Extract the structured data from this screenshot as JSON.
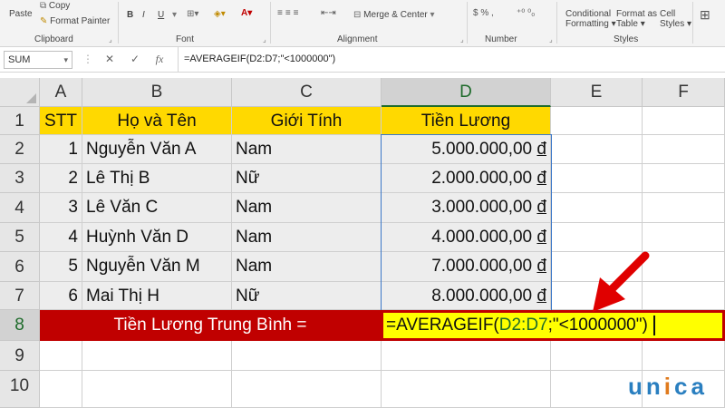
{
  "ribbon": {
    "paste": "Paste",
    "copy": "Copy",
    "format_painter": "Format Painter",
    "clipboard": "Clipboard",
    "font": "Font",
    "alignment": "Alignment",
    "number": "Number",
    "styles": "Styles",
    "merge_center": "Merge & Center",
    "conditional_formatting": "Conditional",
    "conditional_formatting_2": "Formatting",
    "format_as_table": "Format as",
    "format_as_table_2": "Table",
    "cell_styles": "Cell",
    "cell_styles_2": "Styles",
    "bold": "B",
    "italic": "I",
    "underline": "U"
  },
  "formula_bar": {
    "name_box": "SUM",
    "cancel": "✕",
    "enter": "✓",
    "fx": "fx",
    "formula": "=AVERAGEIF(D2:D7;\"<1000000\")"
  },
  "columns": [
    "A",
    "B",
    "C",
    "D",
    "E",
    "F"
  ],
  "rows": [
    "1",
    "2",
    "3",
    "4",
    "5",
    "6",
    "7",
    "8",
    "9",
    "10"
  ],
  "table": {
    "headers": [
      "STT",
      "Họ và Tên",
      "Giới Tính",
      "Tiền Lương"
    ],
    "data": [
      {
        "stt": "1",
        "name": "Nguyễn Văn A",
        "gender": "Nam",
        "salary": "5.000.000,00",
        "currency": "đ"
      },
      {
        "stt": "2",
        "name": "Lê Thị B",
        "gender": "Nữ",
        "salary": "2.000.000,00",
        "currency": "đ"
      },
      {
        "stt": "3",
        "name": "Lê Văn C",
        "gender": "Nam",
        "salary": "3.000.000,00",
        "currency": "đ"
      },
      {
        "stt": "4",
        "name": "Huỳnh Văn D",
        "gender": "Nam",
        "salary": "4.000.000,00",
        "currency": "đ"
      },
      {
        "stt": "5",
        "name": "Nguyễn Văn M",
        "gender": "Nam",
        "salary": "7.000.000,00",
        "currency": "đ"
      },
      {
        "stt": "6",
        "name": "Mai Thị H",
        "gender": "Nữ",
        "salary": "8.000.000,00",
        "currency": "đ"
      }
    ],
    "avg_label": "Tiền Lương Trung Bình =",
    "edit_prefix": "=AVERAGEIF(",
    "edit_ref": "D2:D7",
    "edit_suffix": ";\"<1000000\")"
  },
  "logo": {
    "u": "u",
    "n": "n",
    "i": "i",
    "c": "c",
    "a": "a"
  },
  "colors": {
    "header_yellow": "#ffd900",
    "avg_red": "#c00000",
    "edit_yellow": "#ffff00",
    "arrow_red": "#e00000"
  }
}
